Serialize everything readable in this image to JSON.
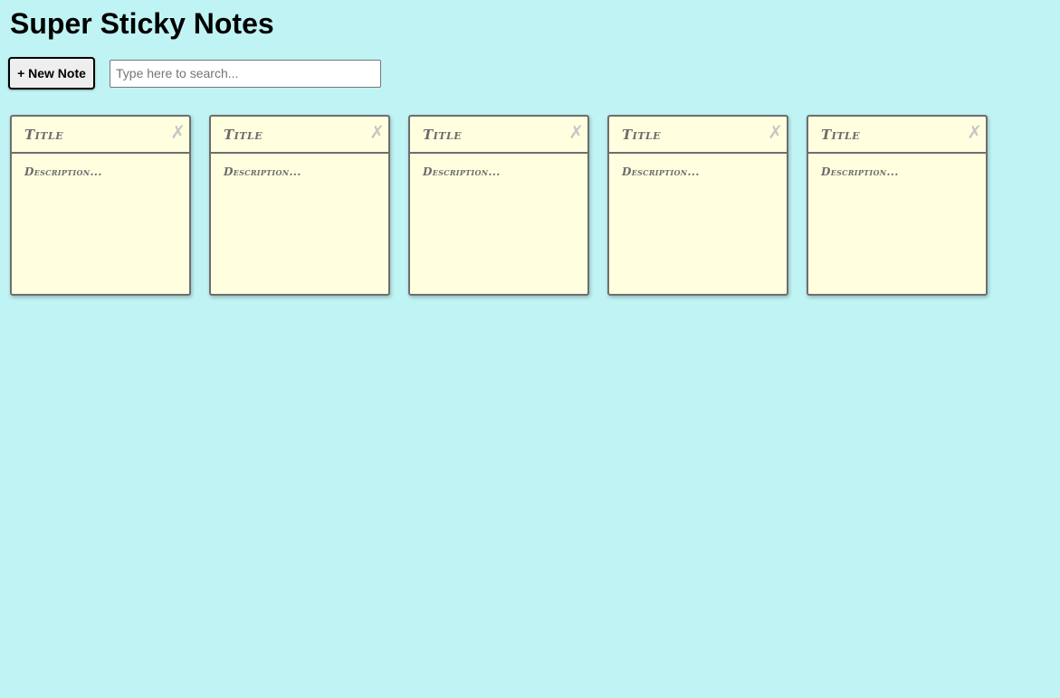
{
  "app": {
    "title": "Super Sticky Notes"
  },
  "toolbar": {
    "new_note_label": "+ New Note",
    "search_placeholder": "Type here to search..."
  },
  "notes": [
    {
      "title": "Title",
      "description": "Description...",
      "close_glyph": "✗"
    },
    {
      "title": "Title",
      "description": "Description...",
      "close_glyph": "✗"
    },
    {
      "title": "Title",
      "description": "Description...",
      "close_glyph": "✗"
    },
    {
      "title": "Title",
      "description": "Description...",
      "close_glyph": "✗"
    },
    {
      "title": "Title",
      "description": "Description...",
      "close_glyph": "✗"
    }
  ],
  "colors": {
    "background": "#c0f4f4",
    "note_fill": "#ffffe0",
    "note_border": "#6e6e6e",
    "note_text": "#6b6b6b",
    "close_icon": "#c6c6c6"
  },
  "icons": {
    "close": "close-icon"
  }
}
